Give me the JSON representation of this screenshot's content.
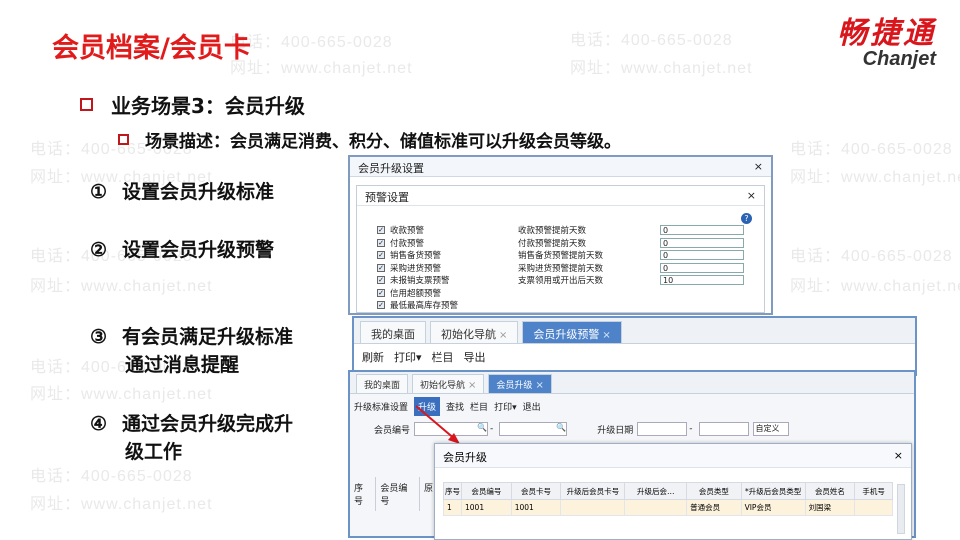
{
  "title": "会员档案/会员卡",
  "logo": {
    "cn": "畅捷通",
    "en": "Chanjet"
  },
  "watermark": {
    "phone": "电话：400-665-0028",
    "site": "网址：www.chanjet.net"
  },
  "bullet1": "业务场景3：会员升级",
  "bullet2": "场景描述：会员满足消费、积分、储值标准可以升级会员等级。",
  "steps": [
    {
      "num": "①",
      "lines": [
        "设置会员升级标准"
      ]
    },
    {
      "num": "②",
      "lines": [
        "设置会员升级预警"
      ]
    },
    {
      "num": "③",
      "lines": [
        "有会员满足升级标准",
        "通过消息提醒"
      ]
    },
    {
      "num": "④",
      "lines": [
        "通过会员升级完成升",
        "级工作"
      ]
    }
  ],
  "win1": {
    "title": "会员升级设置",
    "inner_title": "预警设置",
    "rows": [
      {
        "check": "收款预警",
        "label": "收款预警提前天数",
        "value": "0"
      },
      {
        "check": "付款预警",
        "label": "付款预警提前天数",
        "value": "0"
      },
      {
        "check": "销售备货预警",
        "label": "销售备货预警提前天数",
        "value": "0"
      },
      {
        "check": "采购进货预警",
        "label": "采购进货预警提前天数",
        "value": "0"
      },
      {
        "check": "未报销支票预警",
        "label": "支票领用或开出后天数",
        "value": "10"
      },
      {
        "check": "信用超额预警",
        "label": "",
        "value": ""
      },
      {
        "check": "最低最高库存预警",
        "label": "",
        "value": ""
      }
    ]
  },
  "win2": {
    "tabs": [
      "我的桌面",
      "初始化导航",
      "会员升级预警"
    ],
    "toolbar": [
      "刷新",
      "打印▾",
      "栏目",
      "导出"
    ]
  },
  "win3": {
    "tabs": [
      "我的桌面",
      "初始化导航",
      "会员升级"
    ],
    "toolbar": [
      "升级标准设置",
      "升级",
      "查找",
      "栏目",
      "打印▾",
      "退出"
    ],
    "filter": {
      "member_no": "会员编号",
      "upgrade_date": "升级日期",
      "custom": "自定义"
    },
    "grid_head": [
      "序号",
      "会员编号",
      "原"
    ]
  },
  "dialog": {
    "title": "会员升级",
    "columns": [
      "序号",
      "会员编号",
      "会员卡号",
      "升级后会员卡号",
      "升级后会…",
      "会员类型",
      "*升级后会员类型",
      "会员姓名",
      "手机号"
    ],
    "rows": [
      [
        "1",
        "1001",
        "1001",
        "",
        "",
        "普通会员",
        "VIP会员",
        "刘国梁",
        ""
      ]
    ]
  }
}
